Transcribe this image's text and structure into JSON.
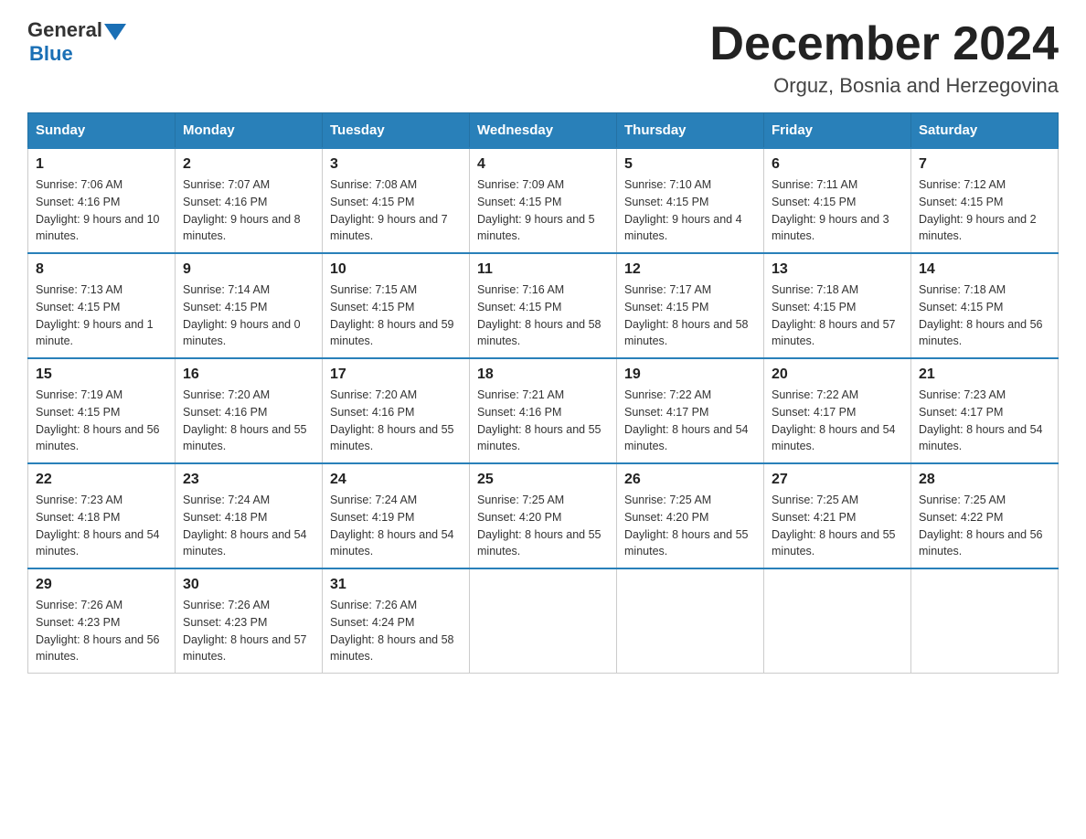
{
  "header": {
    "title": "December 2024",
    "location": "Orguz, Bosnia and Herzegovina",
    "logo_general": "General",
    "logo_blue": "Blue"
  },
  "days_of_week": [
    "Sunday",
    "Monday",
    "Tuesday",
    "Wednesday",
    "Thursday",
    "Friday",
    "Saturday"
  ],
  "weeks": [
    [
      {
        "day": "1",
        "sunrise": "7:06 AM",
        "sunset": "4:16 PM",
        "daylight": "9 hours and 10 minutes."
      },
      {
        "day": "2",
        "sunrise": "7:07 AM",
        "sunset": "4:16 PM",
        "daylight": "9 hours and 8 minutes."
      },
      {
        "day": "3",
        "sunrise": "7:08 AM",
        "sunset": "4:15 PM",
        "daylight": "9 hours and 7 minutes."
      },
      {
        "day": "4",
        "sunrise": "7:09 AM",
        "sunset": "4:15 PM",
        "daylight": "9 hours and 5 minutes."
      },
      {
        "day": "5",
        "sunrise": "7:10 AM",
        "sunset": "4:15 PM",
        "daylight": "9 hours and 4 minutes."
      },
      {
        "day": "6",
        "sunrise": "7:11 AM",
        "sunset": "4:15 PM",
        "daylight": "9 hours and 3 minutes."
      },
      {
        "day": "7",
        "sunrise": "7:12 AM",
        "sunset": "4:15 PM",
        "daylight": "9 hours and 2 minutes."
      }
    ],
    [
      {
        "day": "8",
        "sunrise": "7:13 AM",
        "sunset": "4:15 PM",
        "daylight": "9 hours and 1 minute."
      },
      {
        "day": "9",
        "sunrise": "7:14 AM",
        "sunset": "4:15 PM",
        "daylight": "9 hours and 0 minutes."
      },
      {
        "day": "10",
        "sunrise": "7:15 AM",
        "sunset": "4:15 PM",
        "daylight": "8 hours and 59 minutes."
      },
      {
        "day": "11",
        "sunrise": "7:16 AM",
        "sunset": "4:15 PM",
        "daylight": "8 hours and 58 minutes."
      },
      {
        "day": "12",
        "sunrise": "7:17 AM",
        "sunset": "4:15 PM",
        "daylight": "8 hours and 58 minutes."
      },
      {
        "day": "13",
        "sunrise": "7:18 AM",
        "sunset": "4:15 PM",
        "daylight": "8 hours and 57 minutes."
      },
      {
        "day": "14",
        "sunrise": "7:18 AM",
        "sunset": "4:15 PM",
        "daylight": "8 hours and 56 minutes."
      }
    ],
    [
      {
        "day": "15",
        "sunrise": "7:19 AM",
        "sunset": "4:15 PM",
        "daylight": "8 hours and 56 minutes."
      },
      {
        "day": "16",
        "sunrise": "7:20 AM",
        "sunset": "4:16 PM",
        "daylight": "8 hours and 55 minutes."
      },
      {
        "day": "17",
        "sunrise": "7:20 AM",
        "sunset": "4:16 PM",
        "daylight": "8 hours and 55 minutes."
      },
      {
        "day": "18",
        "sunrise": "7:21 AM",
        "sunset": "4:16 PM",
        "daylight": "8 hours and 55 minutes."
      },
      {
        "day": "19",
        "sunrise": "7:22 AM",
        "sunset": "4:17 PM",
        "daylight": "8 hours and 54 minutes."
      },
      {
        "day": "20",
        "sunrise": "7:22 AM",
        "sunset": "4:17 PM",
        "daylight": "8 hours and 54 minutes."
      },
      {
        "day": "21",
        "sunrise": "7:23 AM",
        "sunset": "4:17 PM",
        "daylight": "8 hours and 54 minutes."
      }
    ],
    [
      {
        "day": "22",
        "sunrise": "7:23 AM",
        "sunset": "4:18 PM",
        "daylight": "8 hours and 54 minutes."
      },
      {
        "day": "23",
        "sunrise": "7:24 AM",
        "sunset": "4:18 PM",
        "daylight": "8 hours and 54 minutes."
      },
      {
        "day": "24",
        "sunrise": "7:24 AM",
        "sunset": "4:19 PM",
        "daylight": "8 hours and 54 minutes."
      },
      {
        "day": "25",
        "sunrise": "7:25 AM",
        "sunset": "4:20 PM",
        "daylight": "8 hours and 55 minutes."
      },
      {
        "day": "26",
        "sunrise": "7:25 AM",
        "sunset": "4:20 PM",
        "daylight": "8 hours and 55 minutes."
      },
      {
        "day": "27",
        "sunrise": "7:25 AM",
        "sunset": "4:21 PM",
        "daylight": "8 hours and 55 minutes."
      },
      {
        "day": "28",
        "sunrise": "7:25 AM",
        "sunset": "4:22 PM",
        "daylight": "8 hours and 56 minutes."
      }
    ],
    [
      {
        "day": "29",
        "sunrise": "7:26 AM",
        "sunset": "4:23 PM",
        "daylight": "8 hours and 56 minutes."
      },
      {
        "day": "30",
        "sunrise": "7:26 AM",
        "sunset": "4:23 PM",
        "daylight": "8 hours and 57 minutes."
      },
      {
        "day": "31",
        "sunrise": "7:26 AM",
        "sunset": "4:24 PM",
        "daylight": "8 hours and 58 minutes."
      },
      null,
      null,
      null,
      null
    ]
  ],
  "labels": {
    "sunrise": "Sunrise:",
    "sunset": "Sunset:",
    "daylight": "Daylight:"
  }
}
